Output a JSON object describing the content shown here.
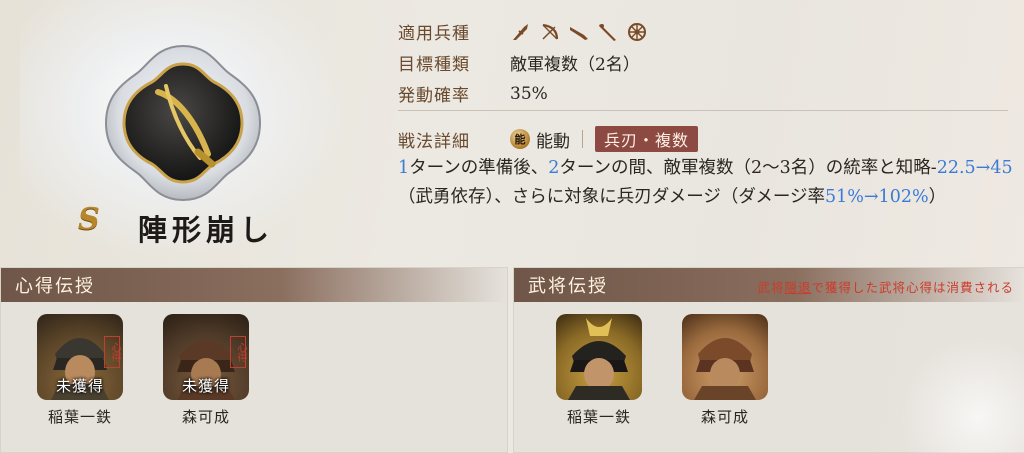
{
  "skill": {
    "rank": "S",
    "name": "陣形崩し",
    "icon": "crossed-blades-icon"
  },
  "info": {
    "troop_label": "適用兵種",
    "troop_icons": [
      "spear-icon",
      "bow-icon",
      "gun-icon",
      "cavalry-icon",
      "wagon-icon"
    ],
    "target_label": "目標種類",
    "target_value": "敵軍複数（2名）",
    "chance_label": "発動確率",
    "chance_value": "35%"
  },
  "tactic": {
    "label": "戦法詳細",
    "type_icon_text": "能",
    "type": "能動",
    "tag": "兵刃・複数",
    "desc": {
      "t1": "1",
      "t2": "ターンの準備後、",
      "t3": "2",
      "t4": "ターンの間、敵軍複数（2〜3名）の統率と知略-",
      "t5": "22.5→45",
      "t6": "（武勇依存）、さらに対象に兵刃ダメージ（ダメージ率",
      "t7": "51%→102%",
      "t8": "）"
    }
  },
  "left_panel": {
    "title": "心得伝授",
    "cards": [
      {
        "name": "稲葉一鉄",
        "status": "未獲得",
        "stamp": "心得"
      },
      {
        "name": "森可成",
        "status": "未獲得",
        "stamp": "心得"
      }
    ]
  },
  "right_panel": {
    "title": "武将伝授",
    "note_pre": "武将",
    "note_link": "隠退",
    "note_post": "で獲得した武将心得は消費される",
    "cards": [
      {
        "name": "稲葉一鉄"
      },
      {
        "name": "森可成"
      }
    ]
  },
  "colors": {
    "accent_blue": "#3a7ad8",
    "warning_red": "#cc3b2b",
    "tag_bg": "#8c4a42",
    "label_brown": "#6a4a2e"
  }
}
